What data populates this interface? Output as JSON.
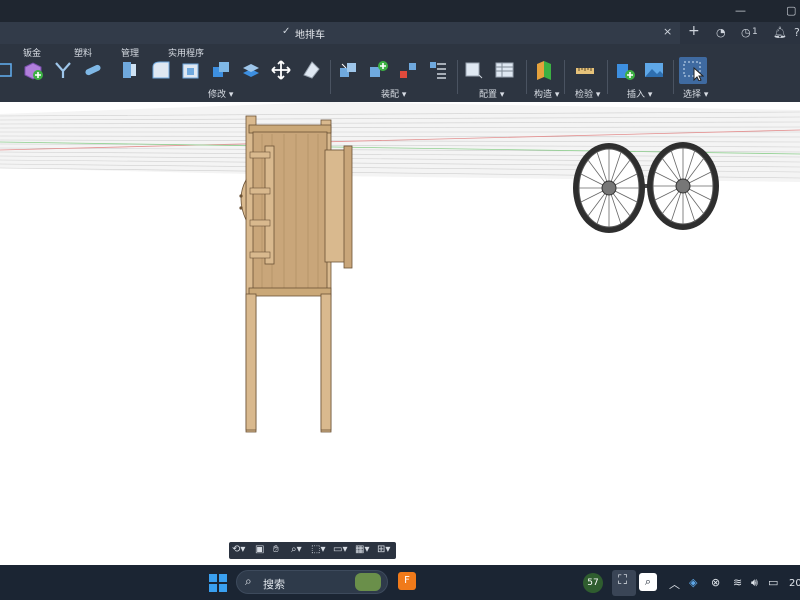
{
  "window": {
    "minimize": "—",
    "maximize": "▢"
  },
  "document_tab": {
    "title": "地排车",
    "close": "×",
    "new_tab": "+"
  },
  "header_icons": {
    "notifications_count": "1"
  },
  "ribbon": {
    "tabs": [
      "钣金",
      "塑料",
      "管理",
      "实用程序"
    ],
    "groups": {
      "modify": "修改",
      "assembly": "装配",
      "config": "配置",
      "construct": "构造",
      "inspect": "检验",
      "insert": "插入",
      "select": "选择"
    }
  },
  "taskbar": {
    "search_placeholder": "搜索",
    "weather": "57",
    "clock": "20"
  },
  "colors": {
    "ribbon_bg": "#2d3541",
    "taskbar_bg": "#1b2533",
    "wood": "#c9a67a",
    "wheel": "#333333"
  }
}
